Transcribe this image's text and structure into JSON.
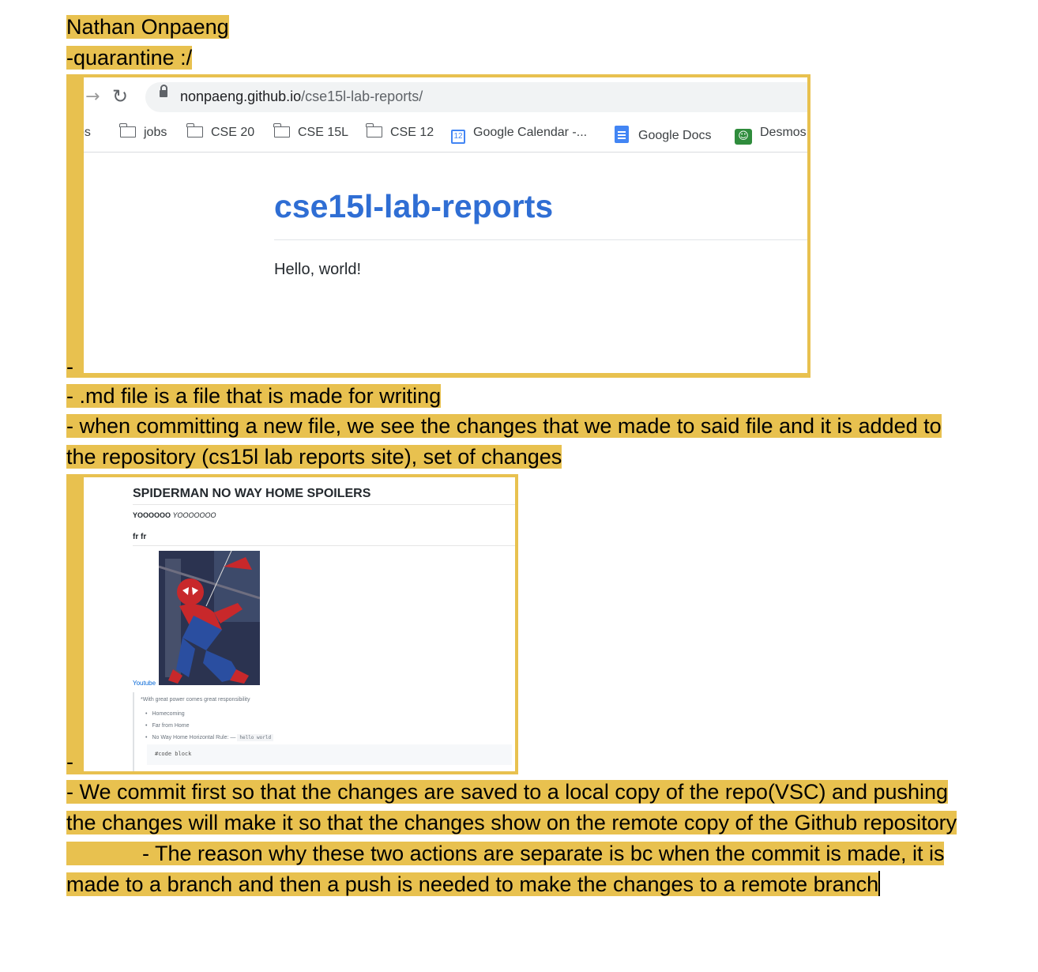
{
  "doc": {
    "name": "Nathan Onpaeng",
    "note": "-quarantine :/",
    "dash1": "-",
    "md_note": "- .md file is a file that is made for writing",
    "commit_note_line1": "- when committing a new file, we see the changes that we made to said file and it is added to",
    "commit_note_line2": "the repository (cs15l lab reports site), set of changes",
    "dash2": "-",
    "push_note_line1": "- We commit first so that the changes are saved to a local copy of the repo(VSC) and pushing",
    "push_note_line2": "the changes will make it so that the changes show on the remote copy of the Github repository",
    "reason_line1": "- The reason why these two actions are separate is bc when the commit is made, it is",
    "reason_line2": "made to a branch and then a push is needed to make the changes to a remote branch"
  },
  "browser": {
    "nav_icon": "forward-arrow-icon",
    "reload_icon": "reload-icon",
    "url_host": "nonpaeng.github.io",
    "url_path": "/cse15l-lab-reports/",
    "bookmarks": [
      "ps",
      "jobs",
      "CSE 20",
      "CSE 15L",
      "CSE 12",
      "Google Calendar -...",
      "Google Docs",
      "Desmos"
    ],
    "calendar_day": "12",
    "page_title": "cse15l-lab-reports",
    "page_text": "Hello, world!",
    "title_color": "#2f6ed4"
  },
  "preview": {
    "heading1": "SPIDERMAN NO WAY HOME SPOILERS",
    "heading2_bold": "YOOOOOO",
    "heading2_italic": "YOOOOOOO",
    "heading3": "fr fr",
    "image_icon": "spiderman-comic-cover-image",
    "link": "Youtube",
    "quote": "*With great power comes great responsibility",
    "list": [
      "Homecoming",
      "Far from Home",
      "No Way Home Horizontal Rule: —"
    ],
    "inline_code": "hello world",
    "code_block": "#code block"
  },
  "colors": {
    "highlight": "#e8c14f"
  }
}
